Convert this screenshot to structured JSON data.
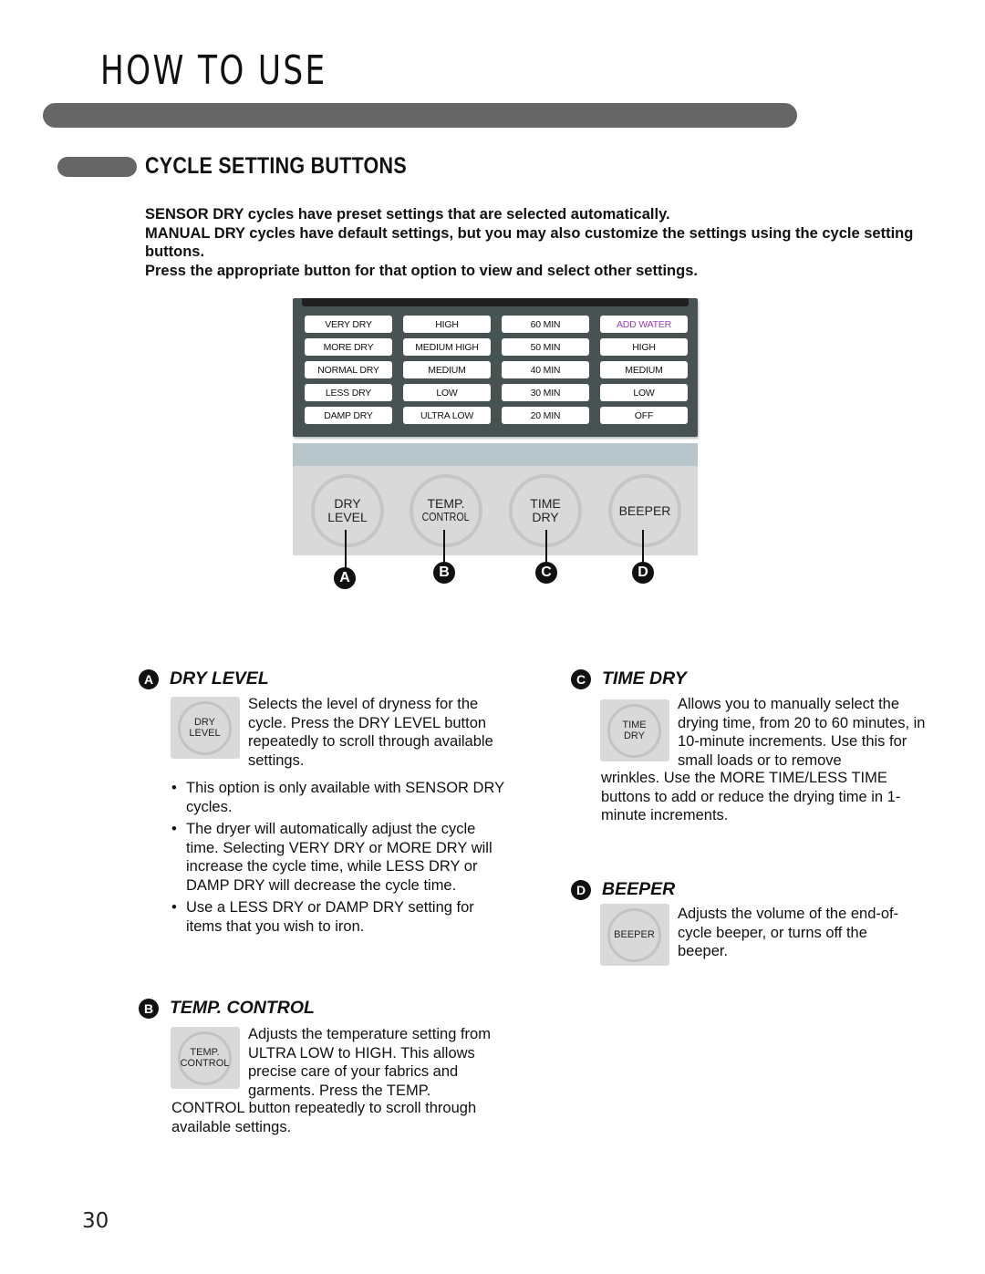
{
  "page_title": "HOW TO USE",
  "section_title": "CYCLE SETTING BUTTONS",
  "intro": [
    "SENSOR DRY cycles have preset settings that are selected automatically.",
    "MANUAL DRY cycles have default settings, but you may also customize the settings using the cycle setting buttons.",
    "Press the appropriate button for that option to view and select other settings."
  ],
  "panel": {
    "columns": [
      {
        "options": [
          "VERY DRY",
          "MORE DRY",
          "NORMAL DRY",
          "LESS DRY",
          "DAMP DRY"
        ]
      },
      {
        "options": [
          "HIGH",
          "MEDIUM HIGH",
          "MEDIUM",
          "LOW",
          "ULTRA LOW"
        ]
      },
      {
        "options": [
          "60 MIN",
          "50 MIN",
          "40 MIN",
          "30 MIN",
          "20 MIN"
        ]
      },
      {
        "options": [
          "ADD WATER",
          "HIGH",
          "MEDIUM",
          "LOW",
          "OFF"
        ]
      }
    ],
    "accent_color": "#9b3fb0",
    "buttons": [
      {
        "line1": "DRY",
        "line2": "LEVEL",
        "callout": "A"
      },
      {
        "line1": "TEMP.",
        "line2": "CONTROL",
        "callout": "B"
      },
      {
        "line1": "TIME",
        "line2": "DRY",
        "callout": "C"
      },
      {
        "line1": "BEEPER",
        "line2": "",
        "callout": "D"
      }
    ]
  },
  "descriptions": {
    "dry_level": {
      "letter": "A",
      "title": "DRY LEVEL",
      "icon_line1": "DRY",
      "icon_line2": "LEVEL",
      "text": "Selects the level of dryness for the cycle. Press the DRY LEVEL button repeatedly to scroll through available settings.",
      "bullets": [
        "This option is only available with SENSOR DRY cycles.",
        "The dryer will automatically adjust the cycle time. Selecting VERY DRY or MORE DRY will increase the cycle time, while LESS DRY or DAMP DRY will decrease the cycle time.",
        "Use a LESS DRY or DAMP DRY setting for items that you wish to iron."
      ]
    },
    "temp_control": {
      "letter": "B",
      "title": "TEMP. CONTROL",
      "icon_line1": "TEMP.",
      "icon_line2": "CONTROL",
      "text_wrap": "Adjusts the temperature setting from ULTRA LOW to HIGH. This allows precise care of your fabrics and garments. Press the TEMP.",
      "text_rest": "CONTROL button repeatedly to scroll through available settings."
    },
    "time_dry": {
      "letter": "C",
      "title": "TIME DRY",
      "icon_line1": "TIME",
      "icon_line2": "DRY",
      "text_wrap": "Allows you to manually select the drying time, from 20 to 60 minutes, in 10-minute increments. Use this for small loads or to remove",
      "text_rest": "wrinkles. Use the MORE TIME/LESS TIME buttons to add or reduce the drying time in 1-minute increments."
    },
    "beeper": {
      "letter": "D",
      "title": "BEEPER",
      "icon_line1": "BEEPER",
      "text": "Adjusts the volume of the end-of-cycle beeper, or turns off the beeper."
    }
  },
  "page_number": "30"
}
